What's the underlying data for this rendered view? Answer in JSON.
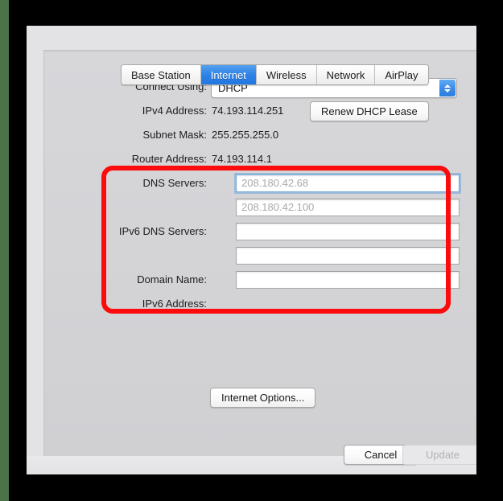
{
  "window": {
    "tabs": [
      {
        "label": "Base Station",
        "selected": false
      },
      {
        "label": "Internet",
        "selected": true
      },
      {
        "label": "Wireless",
        "selected": false
      },
      {
        "label": "Network",
        "selected": false
      },
      {
        "label": "AirPlay",
        "selected": false
      }
    ]
  },
  "form": {
    "connect_using": {
      "label": "Connect Using:",
      "value": "DHCP"
    },
    "ipv4_address": {
      "label": "IPv4 Address:",
      "value": "74.193.114.251"
    },
    "renew_dhcp_lease_button": "Renew DHCP Lease",
    "subnet_mask": {
      "label": "Subnet Mask:",
      "value": "255.255.255.0"
    },
    "router_address": {
      "label": "Router Address:",
      "value": "74.193.114.1"
    },
    "dns_servers": {
      "label": "DNS Servers:",
      "primary_value": "208.180.42.68",
      "secondary_value": "208.180.42.100"
    },
    "ipv6_dns_servers": {
      "label": "IPv6 DNS Servers:",
      "primary_value": "",
      "secondary_value": ""
    },
    "domain_name": {
      "label": "Domain Name:",
      "value": ""
    },
    "ipv6_address": {
      "label": "IPv6 Address:",
      "value": ""
    }
  },
  "buttons": {
    "internet_options": "Internet Options...",
    "cancel": "Cancel",
    "update": "Update"
  },
  "annotation": {
    "highlight_color": "#fb0b0b"
  },
  "colors": {
    "accent_blue": "#2f83e6",
    "window_background": "#e3e3e6",
    "panel_background": "#d3d3d6",
    "placeholder_text": "#a9a9a9"
  }
}
